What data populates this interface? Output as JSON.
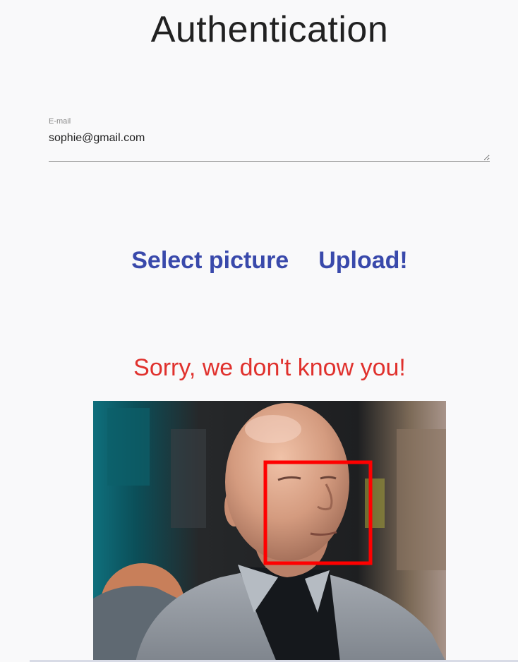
{
  "page": {
    "title": "Authentication"
  },
  "form": {
    "email_label": "E-mail",
    "email_value": "sophie@gmail.com"
  },
  "actions": {
    "select_label": "Select picture",
    "upload_label": "Upload!"
  },
  "result": {
    "message": "Sorry, we don't know you!"
  },
  "colors": {
    "background": "#f9f9fa",
    "accent": "#3949ab",
    "error": "#e0312d",
    "face_box": "#ff0000"
  }
}
